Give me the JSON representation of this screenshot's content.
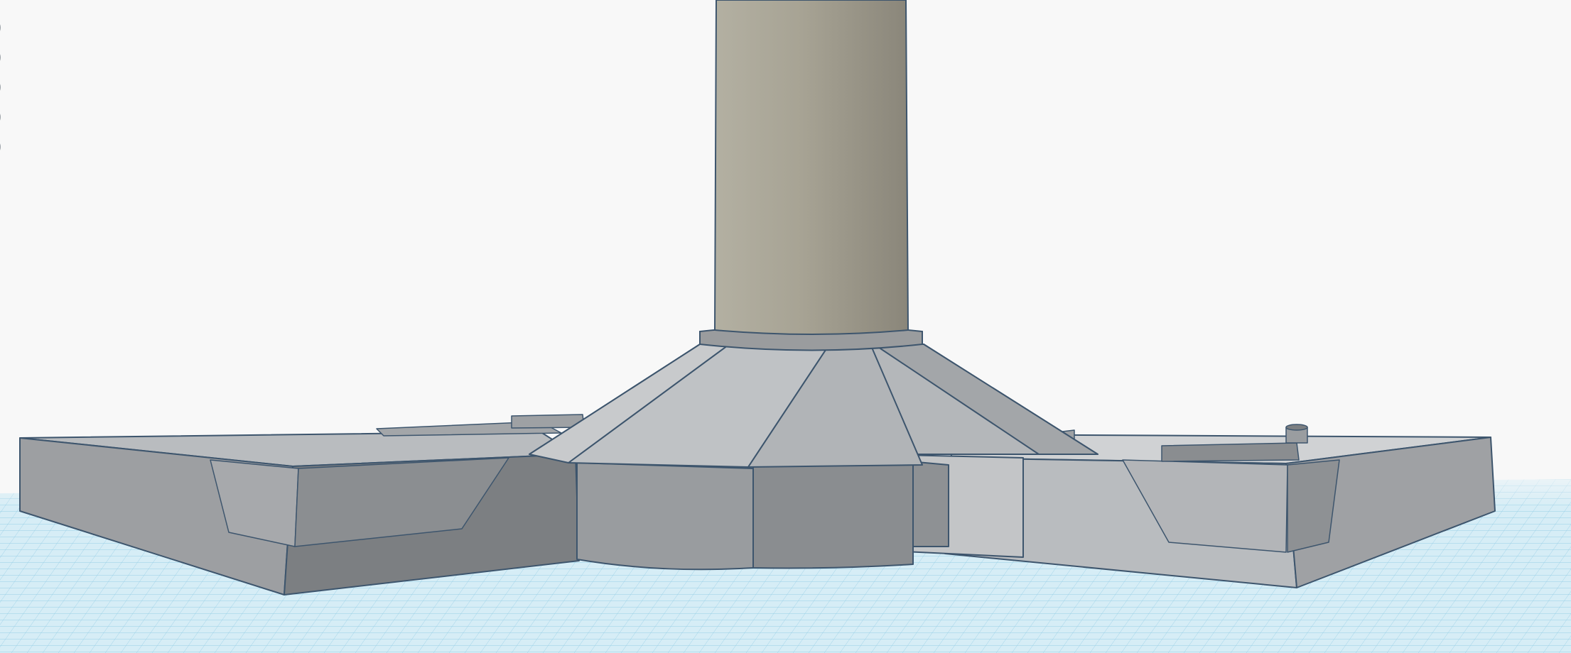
{
  "workplane": {
    "grid_color": "#7fc4e0",
    "background_color": "#f8f8f8"
  },
  "model": {
    "column_color": "#a9a596",
    "base_color": "#97999b",
    "edge_color": "#3d556d"
  },
  "view_controls": [
    {
      "icon": "view-dot-icon"
    },
    {
      "icon": "view-dot-icon"
    },
    {
      "icon": "view-dot-icon"
    },
    {
      "icon": "view-dot-icon"
    },
    {
      "icon": "view-dot-icon"
    }
  ]
}
